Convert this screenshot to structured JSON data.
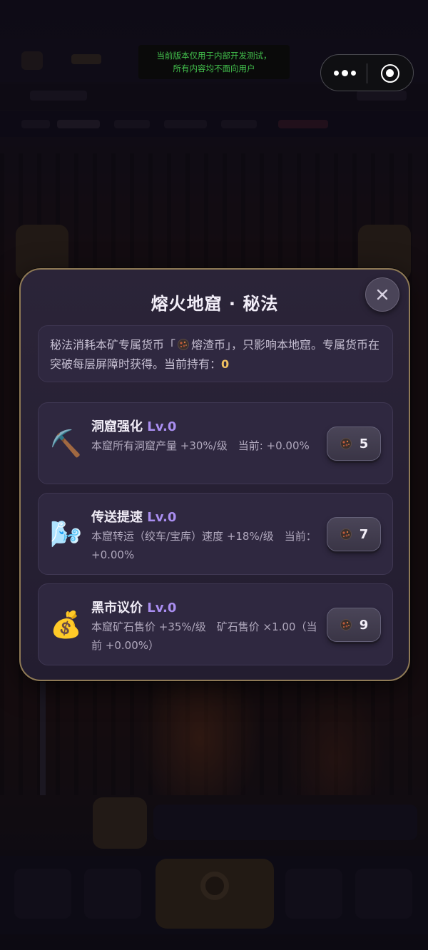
{
  "system": {
    "dev_notice_line1": "当前版本仅用于内部开发测试，",
    "dev_notice_line2": "所有内容均不面向用户"
  },
  "modal": {
    "title": "熔火地窟 · 秘法",
    "info": {
      "text_before": "秘法消耗本矿专属货币「",
      "currency_name": "熔渣币",
      "text_after": "」，只影响本地窟。专属货币在突破每层屏障时获得。当前持有：",
      "held": "0"
    },
    "upgrades": [
      {
        "icon": "pickaxe-icon",
        "emoji": "⛏️",
        "name": "洞窟强化",
        "level": "Lv.0",
        "desc": "本窟所有洞窟产量 +30%/级　当前: +0.00%",
        "cost": "5"
      },
      {
        "icon": "wind-icon",
        "emoji": "🌬️",
        "name": "传送提速",
        "level": "Lv.0",
        "desc": "本窟转运（绞车/宝库）速度 +18%/级　当前：+0.00%",
        "cost": "7"
      },
      {
        "icon": "money-bag-icon",
        "emoji": "💰",
        "name": "黑市议价",
        "level": "Lv.0",
        "desc": "本窟矿石售价 +35%/级　矿石售价 ×1.00（当前 +0.00%）",
        "cost": "9"
      }
    ]
  },
  "colors": {
    "accent_level": "#a98ef0",
    "held_value": "#f0c060",
    "modal_border": "#8f7a56",
    "dev_notice_text": "#43c24d"
  }
}
